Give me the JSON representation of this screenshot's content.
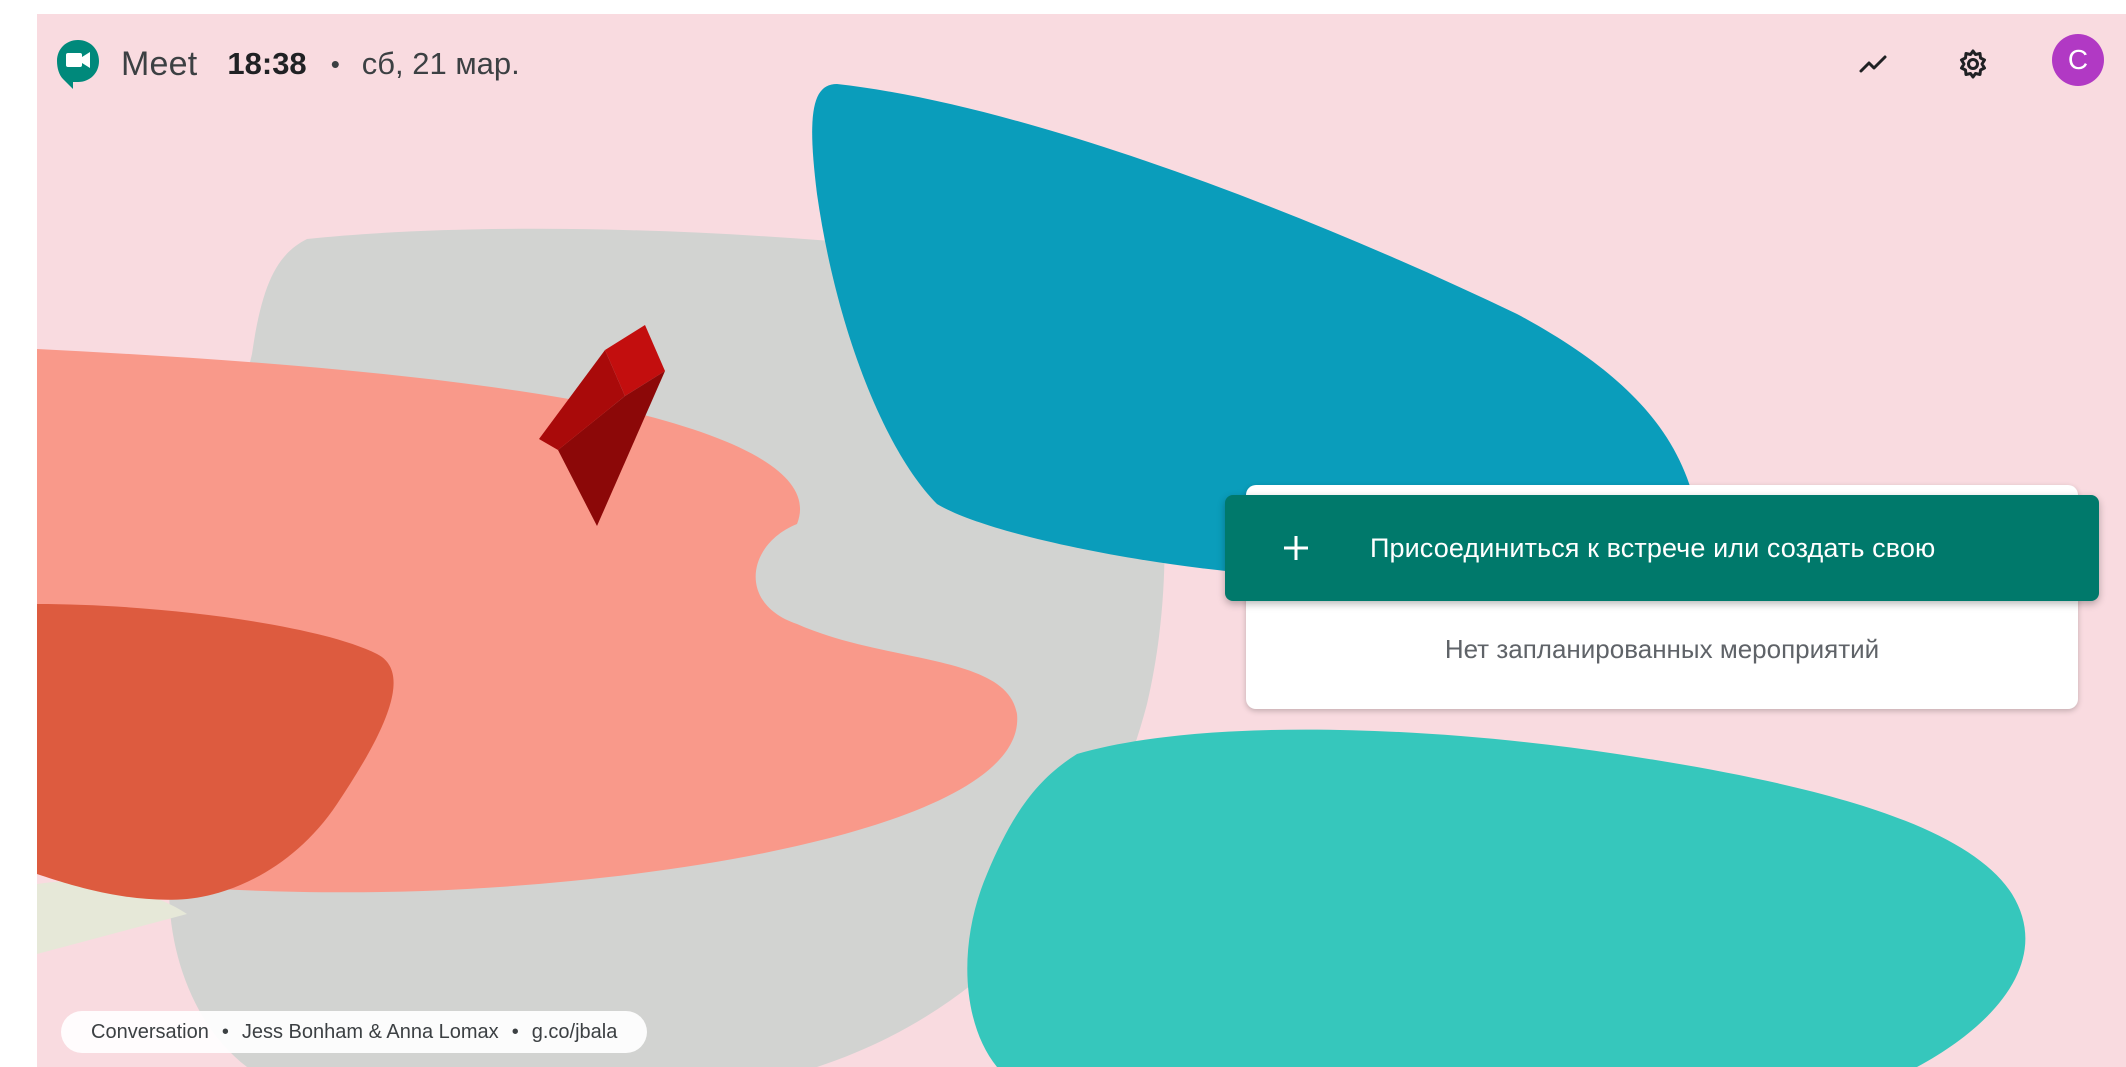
{
  "header": {
    "app_name": "Meet",
    "time": "18:38",
    "separator": "•",
    "date": "сб, 21 мар.",
    "actions": [
      {
        "name": "analytics-icon"
      },
      {
        "name": "gear-icon"
      },
      {
        "name": "feedback-icon"
      }
    ],
    "avatar_letter": "C"
  },
  "main": {
    "join_button_label": "Присоединиться к встрече или создать свою",
    "join_icon": "plus-icon",
    "empty_state": "Нет запланированных мероприятий"
  },
  "credit": {
    "title": "Conversation",
    "artists": "Jess Bonham & Anna Lomax",
    "link": "g.co/jbala",
    "separator": "•"
  },
  "colors": {
    "background": "#f9dbe0",
    "accent_green": "#00796b",
    "avatar": "#b139c4",
    "logo_green": "#00897b"
  }
}
